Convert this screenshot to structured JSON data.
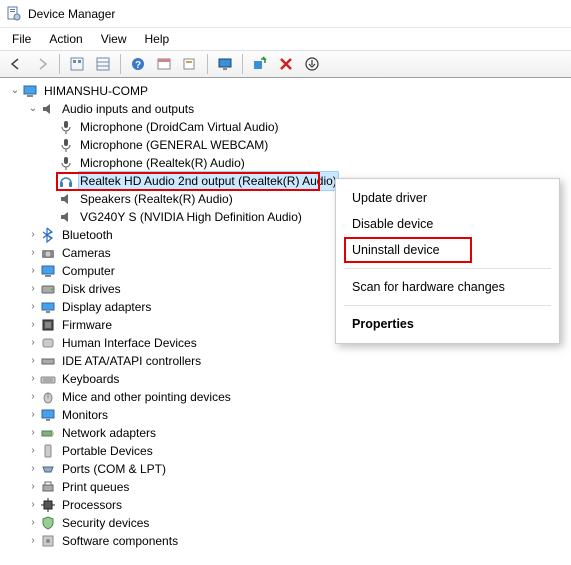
{
  "title": "Device Manager",
  "menu": {
    "file": "File",
    "action": "Action",
    "view": "View",
    "help": "Help"
  },
  "toolbar_icons": [
    "back",
    "forward",
    "up",
    "show-hidden",
    "help",
    "properties",
    "action-center",
    "monitor",
    "scan",
    "delete",
    "update"
  ],
  "root": "HIMANSHU-COMP",
  "audio": {
    "label": "Audio inputs and outputs",
    "children": [
      "Microphone (DroidCam Virtual Audio)",
      "Microphone (GENERAL WEBCAM)",
      "Microphone (Realtek(R) Audio)",
      "Realtek HD Audio 2nd output (Realtek(R) Audio)",
      "Speakers (Realtek(R) Audio)",
      "VG240Y S (NVIDIA High Definition Audio)"
    ]
  },
  "cats": [
    "Bluetooth",
    "Cameras",
    "Computer",
    "Disk drives",
    "Display adapters",
    "Firmware",
    "Human Interface Devices",
    "IDE ATA/ATAPI controllers",
    "Keyboards",
    "Mice and other pointing devices",
    "Monitors",
    "Network adapters",
    "Portable Devices",
    "Ports (COM & LPT)",
    "Print queues",
    "Processors",
    "Security devices",
    "Software components"
  ],
  "context": {
    "update": "Update driver",
    "disable": "Disable device",
    "uninstall": "Uninstall device",
    "scan": "Scan for hardware changes",
    "properties": "Properties"
  }
}
